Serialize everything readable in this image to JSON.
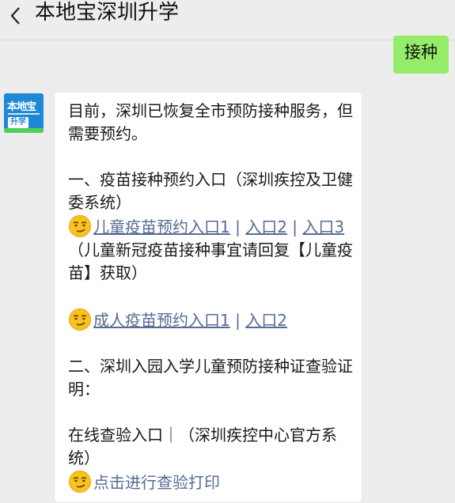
{
  "header": {
    "back_icon": "chevron-left-icon",
    "title": "本地宝深圳升学"
  },
  "outgoing": {
    "text": "接种"
  },
  "avatar": {
    "line1": "本地宝",
    "line2": "升学"
  },
  "incoming": {
    "intro": "目前，深圳已恢复全市预防接种服务，但需要预约。",
    "section1_title": "一、疫苗接种预约入口（深圳疾控及卫健委系统）",
    "child_link1": "儿童疫苗预约入口1",
    "child_link2": "入口2",
    "child_link3": "入口3",
    "separator": "|",
    "child_note": "（儿童新冠疫苗接种事宜请回复【儿童疫苗】获取）",
    "adult_link1": "成人疫苗预约入口1",
    "adult_link2": "入口2",
    "section2_title": "二、深圳入园入学儿童预防接种证查验证明：",
    "online_text": "在线查验入口｜（深圳疾控中心官方系统）",
    "print_link": "点击进行查验打印",
    "emoji_icon": "smirking-face-icon"
  }
}
